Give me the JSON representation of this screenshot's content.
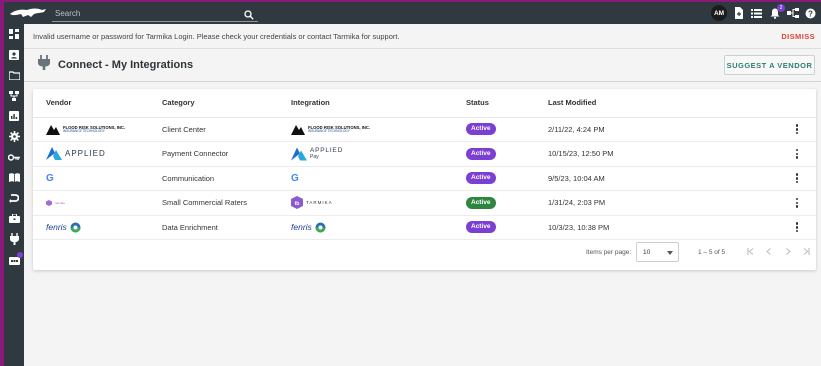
{
  "topbar": {
    "search_placeholder": "Search",
    "avatar_initials": "AM",
    "notification_count": "2"
  },
  "alert": {
    "message": "Invalid username or password for Tarmika Login. Please check your credentials or contact Tarmika for support.",
    "dismiss_label": "DISMISS"
  },
  "page": {
    "title": "Connect - My Integrations",
    "suggest_button": "SUGGEST A VENDOR"
  },
  "table": {
    "headers": {
      "vendor": "Vendor",
      "category": "Category",
      "integration": "Integration",
      "status": "Status",
      "last_modified": "Last Modified"
    },
    "rows": [
      {
        "vendor": "FLOOD RISK SOLUTIONS, INC.",
        "vendor_sub": "INSURANCE TECHNOLOGY",
        "category": "Client Center",
        "integration": "FLOOD RISK SOLUTIONS, INC.",
        "integration_sub": "INSURANCE TECHNOLOGY",
        "status": "Active",
        "last_modified": "2/11/22, 4:24 PM"
      },
      {
        "vendor": "APPLIED",
        "category": "Payment Connector",
        "integration": "APPLIED",
        "integration_sub": "Pay",
        "status": "Active",
        "last_modified": "10/15/23, 12:50 PM"
      },
      {
        "vendor": "G",
        "category": "Communication",
        "integration": "G",
        "status": "Active",
        "last_modified": "9/5/23, 10:04 AM"
      },
      {
        "vendor": "tarmika",
        "category": "Small Commercial Raters",
        "integration": "TARMIKA",
        "status": "Active",
        "last_modified": "1/31/24, 2:03 PM"
      },
      {
        "vendor": "fenris",
        "category": "Data Enrichment",
        "integration": "fenris",
        "status": "Active",
        "last_modified": "10/3/23, 10:38 PM"
      }
    ]
  },
  "paginator": {
    "items_per_page_label": "Items per page:",
    "page_size": "10",
    "range": "1 – 5 of 5"
  },
  "colors": {
    "topbar": "#30393f",
    "active_purple": "#7b3fd3",
    "active_green": "#2e8540",
    "dismiss": "#e0453a",
    "suggest": "#2f7d74",
    "applied_blue": "#1a6fcf"
  }
}
